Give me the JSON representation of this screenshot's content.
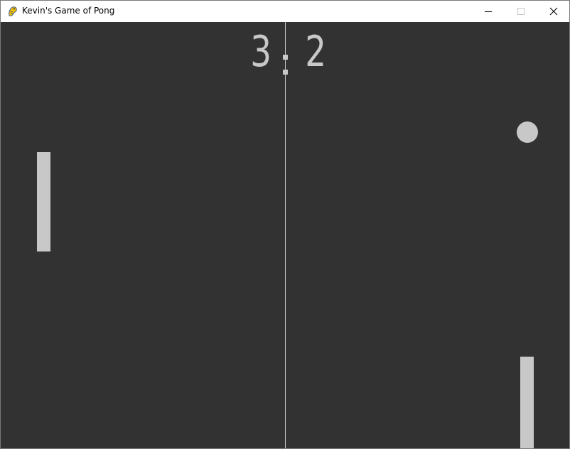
{
  "window": {
    "title": "Kevin's Game of Pong",
    "app_icon": "pygame-snake-icon",
    "controls": {
      "minimize_icon": "minimize-icon",
      "maximize_icon": "maximize-icon",
      "close_icon": "close-icon"
    }
  },
  "game": {
    "score": {
      "left": "3",
      "right": "2"
    },
    "colors": {
      "background": "#323232",
      "foreground": "#c8c8c8"
    }
  }
}
